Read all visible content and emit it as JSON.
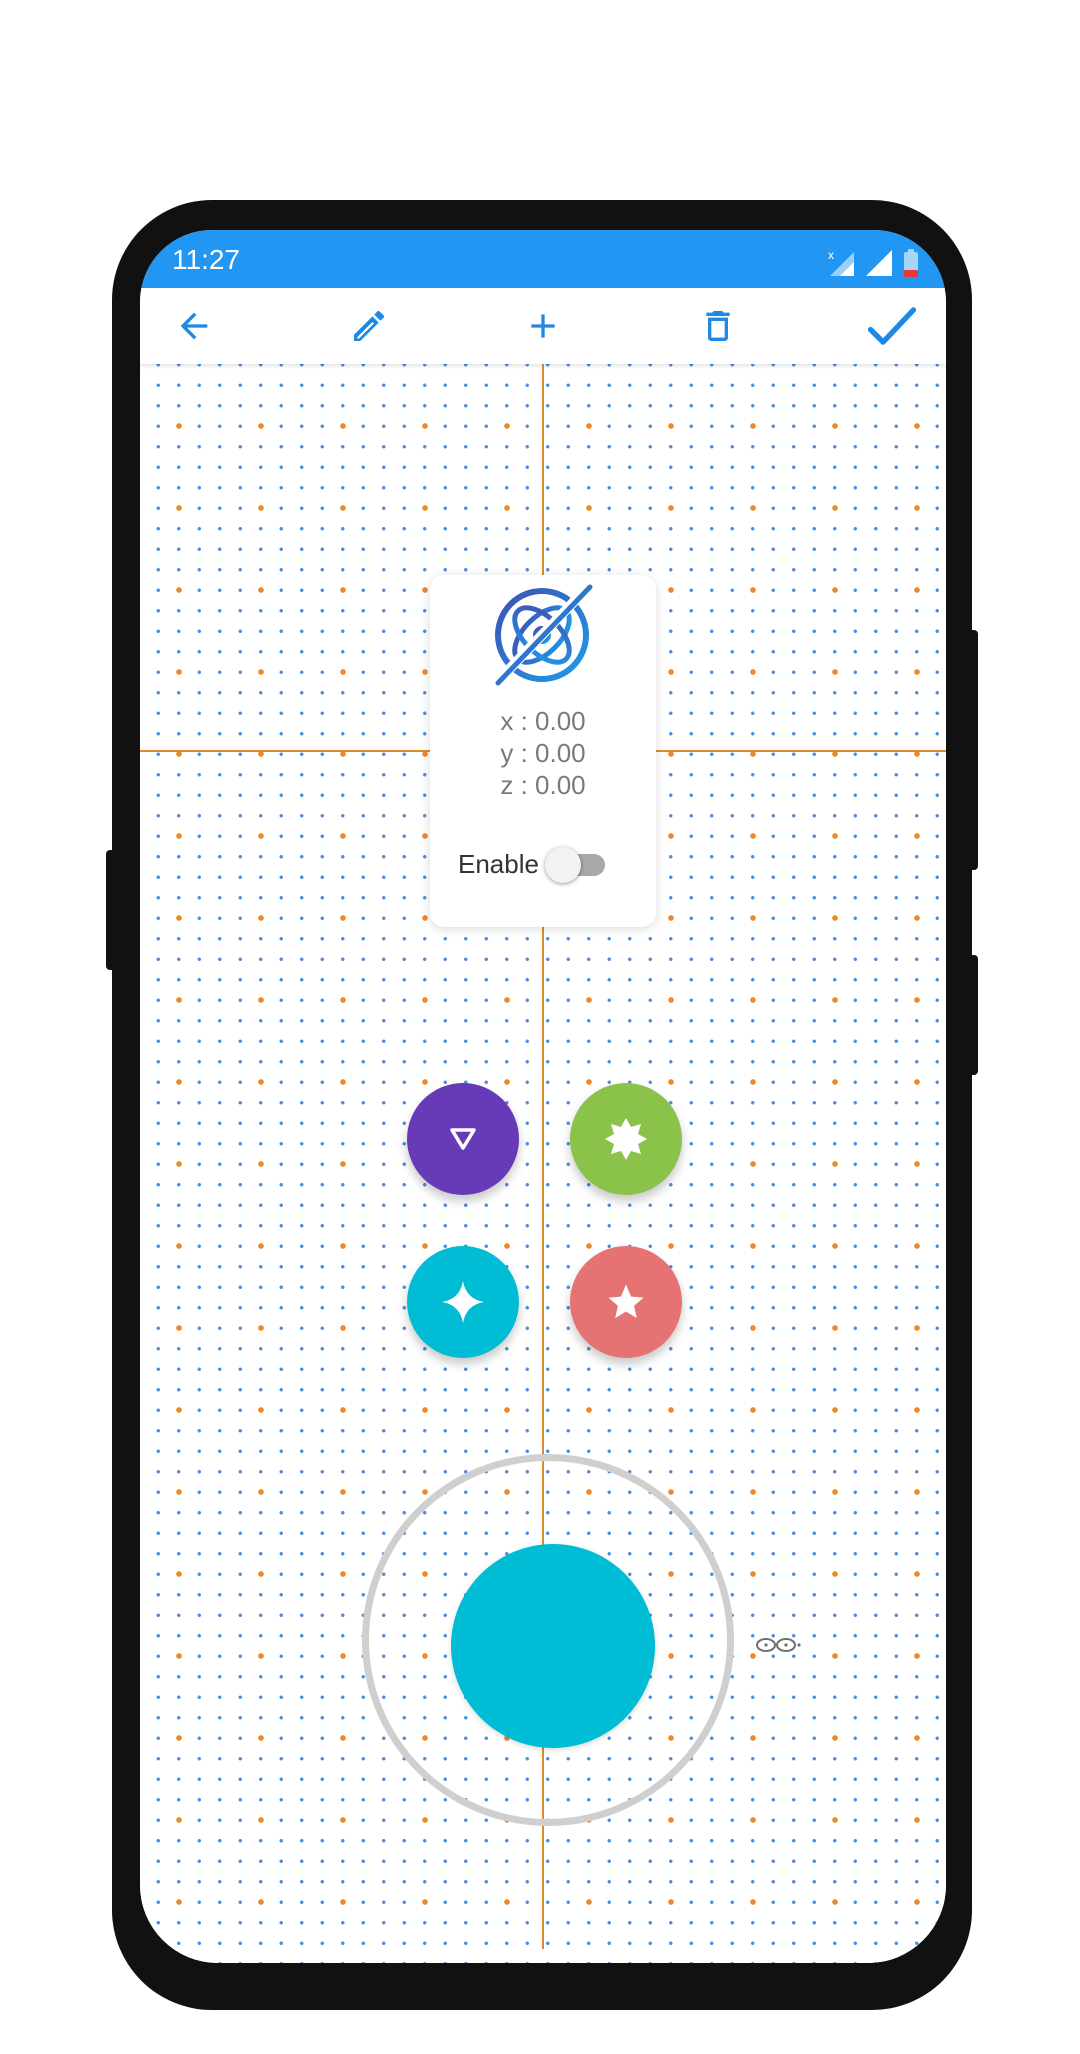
{
  "status_bar": {
    "time": "11:27",
    "color": "#2196f3",
    "icons": [
      "no-sim-signal-icon",
      "signal-icon",
      "battery-low-icon"
    ]
  },
  "toolbar": {
    "color": "#1e88e5",
    "buttons": [
      "back-arrow-icon",
      "pencil-icon",
      "plus-icon",
      "trash-icon",
      "check-icon"
    ]
  },
  "card": {
    "icon": "gyroscope-off-icon",
    "x": "x : 0.00",
    "y": "y : 0.00",
    "z": "z : 0.00",
    "enable_label": "Enable",
    "enabled": false
  },
  "buttons": [
    {
      "name": "triangle",
      "color": "#673ab7",
      "icon": "triangle-down-icon"
    },
    {
      "name": "octagram",
      "color": "#8bc34a",
      "icon": "star-burst-icon"
    },
    {
      "name": "sparkle",
      "color": "#00bcd4",
      "icon": "four-point-star-icon"
    },
    {
      "name": "star",
      "color": "#e57373",
      "icon": "star-icon"
    }
  ],
  "joystick": {
    "knob_color": "#00bcd4",
    "ring_color": "#cfcfcf",
    "indicator_icon": "infinity-icon"
  },
  "grid": {
    "major_dot_color": "#f0862e",
    "minor_dot_color": "#4a8ee0",
    "axis_color": "#e08a2c"
  }
}
